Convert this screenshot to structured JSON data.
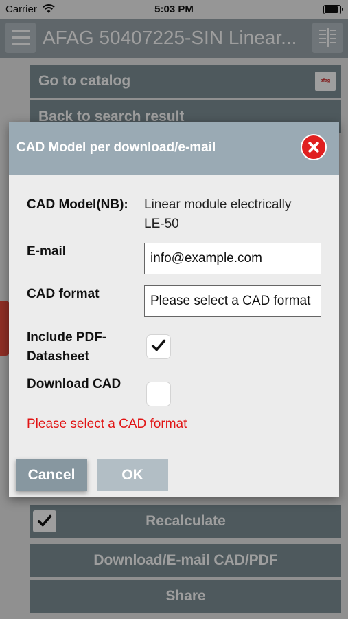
{
  "status_bar": {
    "carrier": "Carrier",
    "time": "5:03 PM"
  },
  "nav_bar": {
    "title": "AFAG 50407225-SIN Linear..."
  },
  "background": {
    "go_to_catalog": "Go to catalog",
    "back_to_search": "Back to search result",
    "recalculate": "Recalculate",
    "download_email": "Download/E-mail CAD/PDF",
    "share": "Share",
    "logo_text": "afag"
  },
  "dialog": {
    "title": "CAD Model per download/e-mail",
    "cad_model_label": "CAD Model(NB):",
    "cad_model_value_line1": "Linear module electrically",
    "cad_model_value_line2": "LE-50",
    "email_label": "E-mail",
    "email_value": "info@example.com",
    "cad_format_label": "CAD format",
    "cad_format_value": "Please select a CAD format",
    "include_pdf_label_line1": "Include PDF-",
    "include_pdf_label_line2": "Datasheet",
    "include_pdf_checked": true,
    "download_cad_label": "Download CAD",
    "download_cad_checked": false,
    "error_message": "Please select a CAD format",
    "cancel_label": "Cancel",
    "ok_label": "OK"
  },
  "colors": {
    "header": "#9aaab4",
    "error": "#e11414",
    "close": "#e02020",
    "background_button": "#7f9096"
  }
}
